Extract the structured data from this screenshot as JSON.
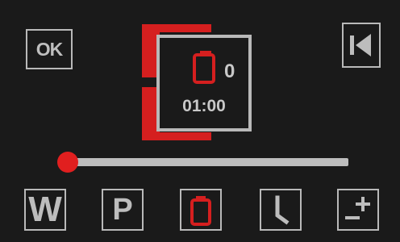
{
  "toolbar": {
    "ok_label": "OK"
  },
  "status": {
    "count": "0",
    "time": "01:00"
  },
  "slider": {
    "value_percent": 0
  },
  "bottom_bar": {
    "w_label": "W",
    "p_label": "P"
  },
  "colors": {
    "background": "#1a1a1a",
    "accent_red": "#d51f1f",
    "control_gray": "#b9b9b9"
  },
  "icons": {
    "back": "skip-back-icon",
    "status": "battery-icon",
    "bottom_battery": "battery-icon",
    "bottom_clock": "clock-hand-icon",
    "bottom_plus_minus": "plus-minus-icon"
  }
}
